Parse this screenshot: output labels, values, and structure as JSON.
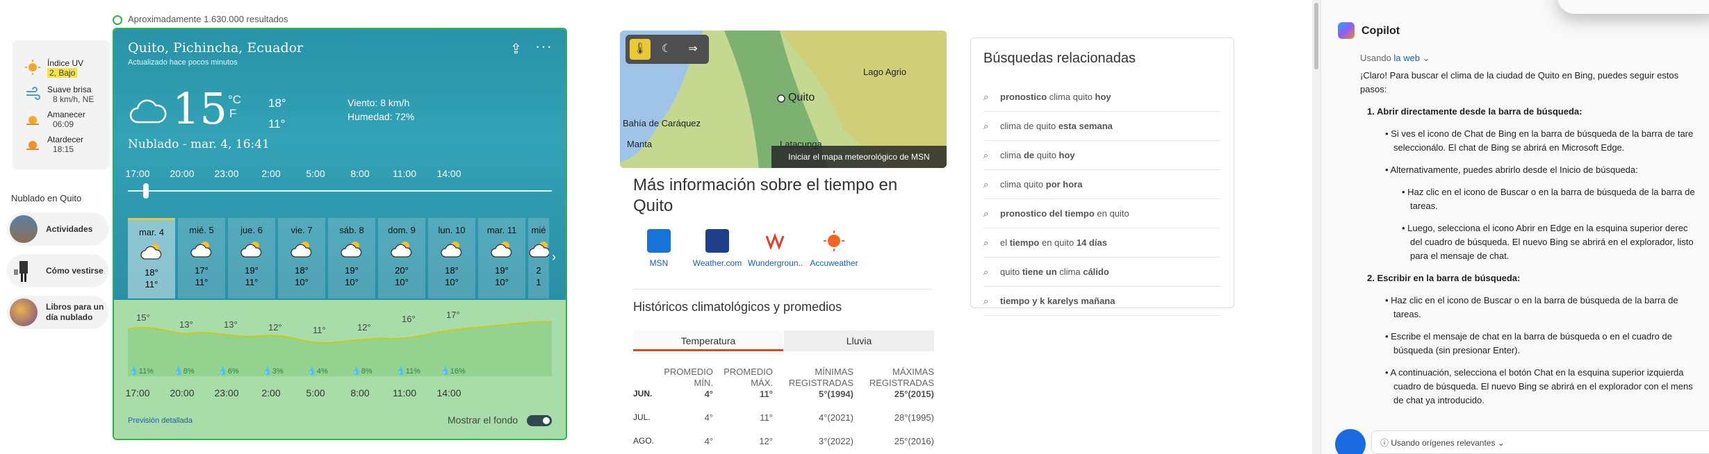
{
  "results": "Aproximadamente 1.630.000 resultados",
  "sidebar": {
    "uv": [
      {
        "title": "Índice UV",
        "value": "2, Bajo",
        "highlight": true
      },
      {
        "title": "Suave brisa",
        "value": "8 km/h, NE"
      },
      {
        "title": "Amanecer",
        "value": "06:09"
      },
      {
        "title": "Atardecer",
        "value": "18:15"
      }
    ],
    "section_title": "Nublado en Quito",
    "items": [
      {
        "label": "Actividades"
      },
      {
        "label": "Cómo vestirse"
      },
      {
        "label_1": "Libros para un",
        "label_2": "día nublado"
      }
    ]
  },
  "weather": {
    "city": "Quito, Pichincha, Ecuador",
    "updated": "Actualizado hace pocos minutos",
    "temp": "15",
    "unit_c": "°C",
    "unit_f": "F",
    "high": "18°",
    "low": "11°",
    "wind": "Viento: 8 km/h",
    "humidity": "Humedad: 72%",
    "condition": "Nublado - mar. 4, 16:41",
    "hours": [
      "17:00",
      "20:00",
      "23:00",
      "2:00",
      "5:00",
      "8:00",
      "11:00",
      "14:00"
    ],
    "days": [
      {
        "name": "mar. 4",
        "high": "18°",
        "low": "11°"
      },
      {
        "name": "mié. 5",
        "high": "17°",
        "low": "11°"
      },
      {
        "name": "jue. 6",
        "high": "19°",
        "low": "11°"
      },
      {
        "name": "vie. 7",
        "high": "18°",
        "low": "10°"
      },
      {
        "name": "sáb. 8",
        "high": "19°",
        "low": "10°"
      },
      {
        "name": "dom. 9",
        "high": "20°",
        "low": "10°"
      },
      {
        "name": "lun. 10",
        "high": "18°",
        "low": "10°"
      },
      {
        "name": "mar. 11",
        "high": "19°",
        "low": "10°"
      },
      {
        "name": "mié",
        "high": "2",
        "low": "1"
      }
    ],
    "graph_temps": [
      "15°",
      "13°",
      "13°",
      "12°",
      "11°",
      "12°",
      "16°",
      "17°"
    ],
    "graph_rain": [
      "11%",
      "8%",
      "6%",
      "3%",
      "4%",
      "8%",
      "11%",
      "16%"
    ],
    "detail_link": "Previsión detallada",
    "show_bg": "Mostrar el fondo"
  },
  "map": {
    "cta": "Iniciar el mapa meteorológico de MSN",
    "labels": {
      "quito": "Quito",
      "lago": "Lago Agrio",
      "bahia": "Bahía de Caráquez",
      "manta": "Manta",
      "lata": "Latacunga"
    }
  },
  "more": {
    "title": "Más información sobre el tiempo en Quito",
    "providers": [
      {
        "name": "MSN",
        "color": "#1773d8"
      },
      {
        "name": "Weather.com",
        "color": "#1f3f8a"
      },
      {
        "name": "Wundergroun...",
        "color": "#ffffff"
      },
      {
        "name": "Accuweather",
        "color": "#ffffff"
      }
    ],
    "hist_title": "Históricos climatológicos y promedios",
    "tabs": [
      "Temperatura",
      "Lluvia"
    ],
    "headers": [
      "PROMEDIO MÍN.",
      "PROMEDIO MÁX.",
      "MÍNIMAS REGISTRADAS",
      "MÁXIMAS REGISTRADAS"
    ],
    "rows": [
      {
        "month": "JUN.",
        "cells": [
          "4°",
          "11°",
          "5°(1994)",
          "25°(2015)"
        ]
      },
      {
        "month": "JUL.",
        "cells": [
          "4°",
          "11°",
          "4°(2021)",
          "28°(1995)"
        ]
      },
      {
        "month": "AGO.",
        "cells": [
          "4°",
          "12°",
          "3°(2022)",
          "25°(2016)"
        ]
      }
    ]
  },
  "related": {
    "title": "Búsquedas relacionadas",
    "items": [
      {
        "bold1": "pronostico",
        "normal": " clima quito ",
        "bold2": "hoy"
      },
      {
        "bold1": "",
        "normal": "clima de quito ",
        "bold2": "esta semana"
      },
      {
        "bold1": "",
        "normal": "clima ",
        "bold2": "de",
        "tail": " quito ",
        "bold3": "hoy"
      },
      {
        "bold1": "",
        "normal": "clima quito ",
        "bold2": "por hora"
      },
      {
        "bold1": "pronostico del tiempo",
        "normal": " en quito",
        "bold2": ""
      },
      {
        "bold1": "",
        "normal": "el ",
        "bold2": "tiempo",
        "tail": " en quito ",
        "bold3": "14 días"
      },
      {
        "bold1": "",
        "normal": "quito ",
        "bold2": "tiene un",
        "tail": " clima ",
        "bold3": "cálido"
      },
      {
        "bold1": "tiempo y k karelys mañana",
        "normal": "",
        "bold2": ""
      }
    ]
  },
  "copilot": {
    "title": "Copilot",
    "using_prefix": "Usando ",
    "using_link": "la web",
    "lines": [
      "¡Claro! Para buscar el clima de la ciudad de Quito en Bing, puedes seguir estos",
      "pasos:"
    ],
    "step1": "Abrir directamente desde la barra de búsqueda:",
    "b1a": "Si ves el icono de Chat de Bing en la barra de búsqueda de la barra de tare",
    "b1a2": "seleccionálo. El chat de Bing se abrirá en Microsoft Edge.",
    "b1b": "Alternativamente, puedes abrirlo desde el Inicio de búsqueda:",
    "b1b_i": "Haz clic en el icono de Buscar o en la barra de búsqueda de la barra de",
    "b1b_i2": "tareas.",
    "b1b_ii": "Luego, selecciona el icono Abrir en Edge en la esquina superior derec",
    "b1b_ii2": "del cuadro de búsqueda. El nuevo Bing se abrirá en el explorador, listo",
    "b1b_ii3": "para el mensaje de chat.",
    "step2": "Escribir en la barra de búsqueda:",
    "b2a": "Haz clic en el icono de Buscar o en la barra de búsqueda de la barra de",
    "b2a2": "tareas.",
    "b2b": "Escribe el mensaje de chat en la barra de búsqueda o en el cuadro de",
    "b2b2": "búsqueda (sin presionar Enter).",
    "b2c": "A continuación, selecciona el botón Chat en la esquina superior izquierda",
    "b2c2": "cuadro de búsqueda. El nuevo Bing se abrirá en el explorador con el mens",
    "b2c3": "de chat ya introducido.",
    "sources": "Usando orígenes relevantes"
  }
}
